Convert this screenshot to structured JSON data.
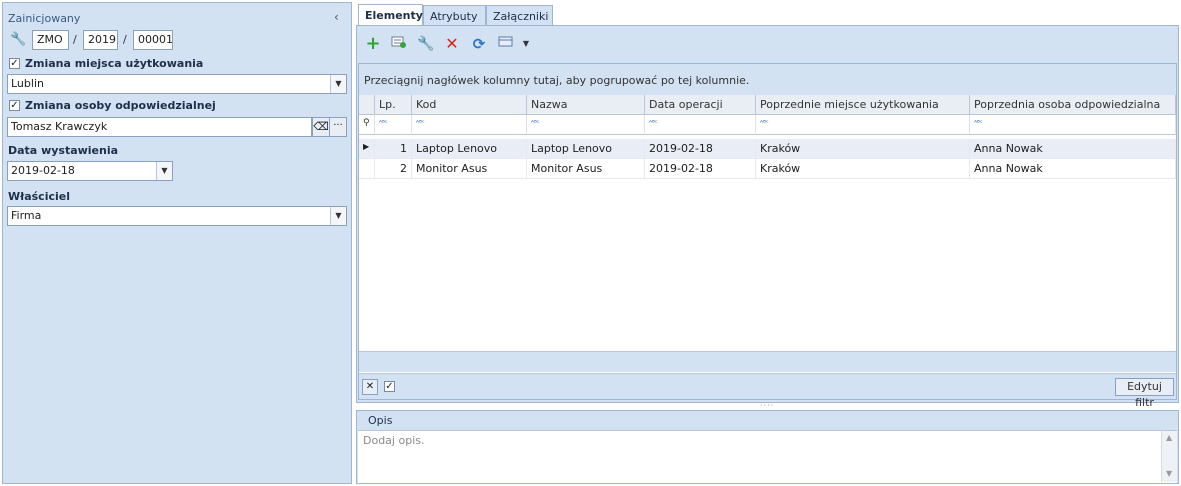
{
  "left": {
    "status": "Zainicjowany",
    "number": {
      "prefix": "ZMO",
      "year": "2019",
      "seq": "00001",
      "sep1": "/",
      "sep2": "/"
    },
    "change_place": {
      "label": "Zmiana miejsca użytkowania",
      "checked": true,
      "value": "Lublin"
    },
    "change_person": {
      "label": "Zmiana osoby odpowiedzialnej",
      "checked": true,
      "value": "Tomasz Krawczyk"
    },
    "issue_date": {
      "label": "Data wystawienia",
      "value": "2019-02-18"
    },
    "owner": {
      "label": "Właściciel",
      "value": "Firma"
    }
  },
  "tabs": [
    "Elementy",
    "Atrybuty",
    "Załączniki"
  ],
  "grid": {
    "group_hint": "Przeciągnij nagłówek kolumny tutaj, aby pogrupować po tej kolumnie.",
    "columns": [
      "Lp.",
      "Kod",
      "Nazwa",
      "Data operacji",
      "Poprzednie miejsce użytkowania",
      "Poprzednia osoba odpowiedzialna"
    ],
    "filter_glyph": "ᴬᴮᶜ",
    "rows": [
      [
        "1",
        "Laptop Lenovo",
        "Laptop Lenovo",
        "2019-02-18",
        "Kraków",
        "Anna Nowak"
      ],
      [
        "2",
        "Monitor Asus",
        "Monitor Asus",
        "2019-02-18",
        "Kraków",
        "Anna Nowak"
      ]
    ],
    "edit_filter": "Edytuj filtr"
  },
  "opis": {
    "title": "Opis",
    "placeholder": "Dodaj opis."
  },
  "icons": [
    "wrench-icon",
    "add-icon",
    "add-from-list-icon",
    "edit-icon",
    "delete-icon",
    "refresh-icon",
    "export-icon"
  ]
}
